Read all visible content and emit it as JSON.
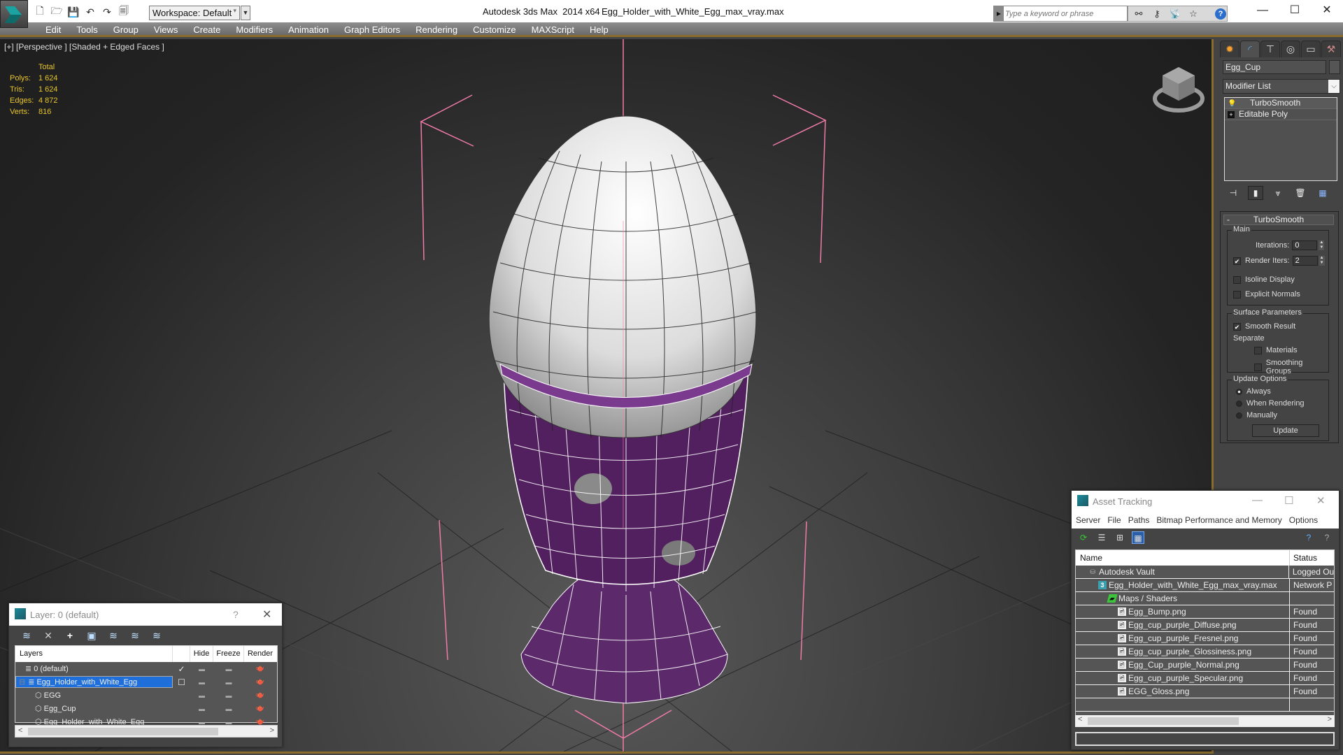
{
  "titlebar": {
    "app_title": "Autodesk 3ds Max  2014 x64",
    "file_name": "Egg_Holder_with_White_Egg_max_vray.max",
    "workspace": "Workspace: Default",
    "search_placeholder": "Type a keyword or phrase",
    "quick_access_icons": [
      "new-file-icon",
      "open-file-icon",
      "save-icon",
      "undo-icon",
      "redo-icon",
      "project-folder-icon"
    ],
    "search_tool_icons": [
      "binoculars-icon",
      "key-icon",
      "satellite-icon",
      "star-icon",
      "help-icon"
    ],
    "window_controls": {
      "minimize": "—",
      "maximize": "☐",
      "close": "✕"
    }
  },
  "menubar": {
    "items": [
      "Edit",
      "Tools",
      "Group",
      "Views",
      "Create",
      "Modifiers",
      "Animation",
      "Graph Editors",
      "Rendering",
      "Customize",
      "MAXScript",
      "Help"
    ]
  },
  "viewport": {
    "label": "[+] [Perspective ] [Shaded + Edged Faces ]",
    "stats": {
      "header": "Total",
      "rows": [
        {
          "label": "Polys:",
          "value": "1 624"
        },
        {
          "label": "Tris:",
          "value": "1 624"
        },
        {
          "label": "Edges:",
          "value": "4 872"
        },
        {
          "label": "Verts:",
          "value": "816"
        }
      ]
    },
    "colors": {
      "stats": "#e8c52a",
      "selection_bracket": "#f07aa8",
      "cup": "#5a2a6a",
      "egg": "#e8e8e8",
      "frame": "#8a6d2d"
    }
  },
  "command_panel": {
    "tabs": [
      "create-tab",
      "modify-tab",
      "hierarchy-tab",
      "motion-tab",
      "display-tab",
      "utilities-tab"
    ],
    "object_name": "Egg_Cup",
    "modifier_list": "Modifier List",
    "stack": [
      {
        "label": "TurboSmooth",
        "icon": "lightbulb-icon"
      },
      {
        "label": "Editable Poly",
        "icon": "plus-icon"
      }
    ],
    "rollout": {
      "title": "TurboSmooth",
      "collapse": "-",
      "main": {
        "title": "Main",
        "iterations_label": "Iterations:",
        "iterations": "0",
        "render_iters_label": "Render Iters:",
        "render_iters": "2",
        "render_iters_checked": true,
        "isoline_display": "Isoline Display",
        "isoline_checked": false,
        "explicit_normals": "Explicit Normals",
        "explicit_checked": false
      },
      "surface": {
        "title": "Surface Parameters",
        "smooth_result": "Smooth Result",
        "smooth_checked": true,
        "separate": "Separate",
        "materials": "Materials",
        "smoothing_groups": "Smoothing Groups"
      },
      "update": {
        "title": "Update Options",
        "options": [
          "Always",
          "When Rendering",
          "Manually"
        ],
        "selected": "Always",
        "button": "Update"
      }
    }
  },
  "layer_dialog": {
    "title": "Layer: 0 (default)",
    "help": "?",
    "close": "✕",
    "columns": [
      "Layers",
      "",
      "Hide",
      "Freeze",
      "Render"
    ],
    "rows": [
      {
        "name": "0 (default)",
        "type": "layer",
        "active": "✓",
        "selected": false
      },
      {
        "name": "Egg_Holder_with_White_Egg",
        "type": "layer",
        "active": "☐",
        "selected": true,
        "expander": "⊟"
      },
      {
        "name": "EGG",
        "type": "object",
        "active": "",
        "selected": false
      },
      {
        "name": "Egg_Cup",
        "type": "object",
        "active": "",
        "selected": false
      },
      {
        "name": "Egg_Holder_with_White_Egg",
        "type": "object",
        "active": "",
        "selected": false
      }
    ]
  },
  "asset_dialog": {
    "title": "Asset Tracking",
    "menu": [
      "Server",
      "File",
      "Paths",
      "Bitmap Performance and Memory",
      "Options"
    ],
    "columns": {
      "name": "Name",
      "status": "Status"
    },
    "rows": [
      {
        "name": "Autodesk Vault",
        "status": "Logged Ou",
        "icon": "vault",
        "indent": 1
      },
      {
        "name": "Egg_Holder_with_White_Egg_max_vray.max",
        "status": "Network P",
        "icon": "max",
        "indent": 2
      },
      {
        "name": "Maps / Shaders",
        "status": "",
        "icon": "maps",
        "indent": 3
      },
      {
        "name": "Egg_Bump.png",
        "status": "Found",
        "icon": "img",
        "indent": 4
      },
      {
        "name": "Egg_cup_purple_Diffuse.png",
        "status": "Found",
        "icon": "img",
        "indent": 4
      },
      {
        "name": "Egg_cup_purple_Fresnel.png",
        "status": "Found",
        "icon": "img",
        "indent": 4
      },
      {
        "name": "Egg_cup_purple_Glossiness.png",
        "status": "Found",
        "icon": "img",
        "indent": 4
      },
      {
        "name": "Egg_Cup_purple_Normal.png",
        "status": "Found",
        "icon": "img",
        "indent": 4
      },
      {
        "name": "Egg_cup_purple_Specular.png",
        "status": "Found",
        "icon": "img",
        "indent": 4
      },
      {
        "name": "EGG_Gloss.png",
        "status": "Found",
        "icon": "img",
        "indent": 4
      }
    ]
  }
}
